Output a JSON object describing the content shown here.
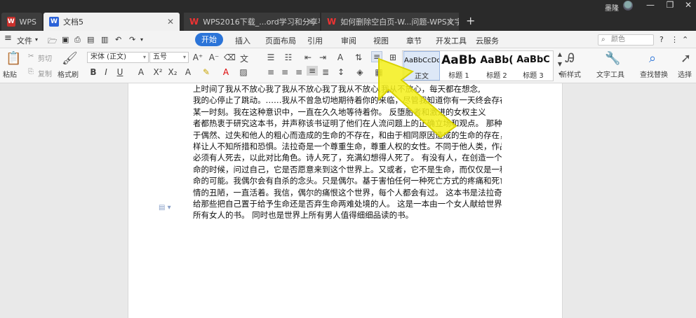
{
  "titlebar": {
    "tabs": [
      {
        "label": "WPS"
      },
      {
        "label": "文档5"
      },
      {
        "label": "WPS2016下载_...ord学习和分享平台"
      },
      {
        "label": "如何删除空白页-W...问题-WPS文字-"
      }
    ],
    "add_tab": "+",
    "user_name": "墨隆",
    "controls": {
      "minimize": "—",
      "restore": "❐",
      "close": "✕"
    }
  },
  "menubar": {
    "file": "文件",
    "items": [
      "开始",
      "插入",
      "页面布局",
      "引用",
      "审阅",
      "视图",
      "章节",
      "开发工具",
      "云服务"
    ],
    "search_placeholder": "颜色",
    "help": "?"
  },
  "ribbon": {
    "paste": "粘贴",
    "cut": "剪切",
    "copy": "复制",
    "format_painter": "格式刷",
    "font_name": "宋体 (正文)",
    "font_size": "五号",
    "styles": [
      {
        "preview": "AaBbCcDd",
        "name": "正文"
      },
      {
        "preview": "AaBb",
        "name": "标题 1"
      },
      {
        "preview": "AaBb(",
        "name": "标题 2"
      },
      {
        "preview": "AaBbC",
        "name": "标题 3"
      }
    ],
    "new_style": "新样式",
    "text_tools": "文字工具",
    "find_replace": "查找替换",
    "select": "选择"
  },
  "document": {
    "lines": [
      "上时间了我从不放心我了我从不放心我了我从不放心,我从不放心，每天都在想念,",
      "我的心停止了跳动。……我从不曾急切地期待着你的来临，尽管我知道你有一天终会存在于",
      "某一时刻。我在这种意识中，一直在久久地等待着你。 反堕胎者和激进的女权主义",
      "者都热衷于研究这本书，并声称该书证明了他们在人流问题上的正确立场和观点。 那种由",
      "于偶然、过失和他人的粗心而造成的生命的不存在，和由于相同原因造成的生命的存在，同",
      "样让人不知所措和恐惧。法拉奇是一个尊重生命，尊重人权的女性。不同于他人类，作品中",
      "必须有人死去，以此对比角色。诗人死了，充满幻想得人死了。 有没有人，在创造一个生",
      "命的时候，问过自己，它是否愿意来到这个世界上。又或者，它不是生命，而仅仅是一种生",
      "命的可能。我偶尔会有自杀的念头。只是偶尔。基于害怕任何一种死亡方式的疼痛和死亡表",
      "情的丑陋，一直活着。我信，偶尔的痛恨这个世界，每个人都会有过。 这本书是法拉奇献",
      "给那些把自己置于给予生命还是否弃生命两难处境的人。 这是一本由一个女人献给世界上",
      "所有女人的书。 同时也是世界上所有男人值得细细品读的书。"
    ]
  }
}
